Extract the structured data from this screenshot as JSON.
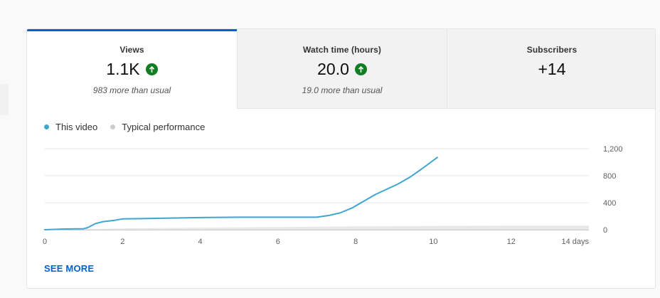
{
  "tabs": [
    {
      "label": "Views",
      "value": "1.1K",
      "subtitle": "983 more than usual",
      "trend": "up",
      "selected": true
    },
    {
      "label": "Watch time (hours)",
      "value": "20.0",
      "subtitle": "19.0 more than usual",
      "trend": "up",
      "selected": false
    },
    {
      "label": "Subscribers",
      "value": "+14",
      "subtitle": "",
      "trend": "none",
      "selected": false
    }
  ],
  "legend": [
    {
      "label": "This video",
      "color": "#3ea6d1"
    },
    {
      "label": "Typical performance",
      "color": "#cccccc"
    }
  ],
  "see_more": "SEE MORE",
  "colors": {
    "accent_bar": "#065fd4",
    "trend_up": "#0f7d22",
    "this_video": "#3ea6d1",
    "typical": "#e6e6e6",
    "grid": "#e5e5e5",
    "axis_text": "#606060"
  },
  "chart_data": {
    "type": "line",
    "x_ticks": [
      "0",
      "2",
      "4",
      "6",
      "8",
      "10",
      "12",
      "14 days"
    ],
    "y_ticks": [
      "0",
      "400",
      "800",
      "1,200"
    ],
    "xlim": [
      0,
      14
    ],
    "ylim": [
      0,
      1200
    ],
    "series": [
      {
        "name": "This video",
        "x": [
          0,
          0.5,
          1.0,
          1.1,
          1.3,
          1.5,
          1.8,
          2.0,
          2.5,
          3.0,
          4.0,
          5.0,
          6.0,
          7.0,
          7.3,
          7.6,
          7.9,
          8.2,
          8.5,
          8.8,
          9.1,
          9.4,
          9.7,
          10.1
        ],
        "y": [
          0,
          10,
          15,
          30,
          90,
          120,
          140,
          160,
          165,
          170,
          180,
          185,
          185,
          185,
          210,
          250,
          320,
          420,
          520,
          600,
          680,
          780,
          900,
          1070
        ]
      },
      {
        "name": "Typical performance",
        "x": [
          0,
          1,
          2,
          4,
          6,
          8,
          10,
          12,
          14
        ],
        "y": [
          0,
          10,
          20,
          30,
          40,
          50,
          55,
          60,
          60
        ]
      }
    ]
  }
}
